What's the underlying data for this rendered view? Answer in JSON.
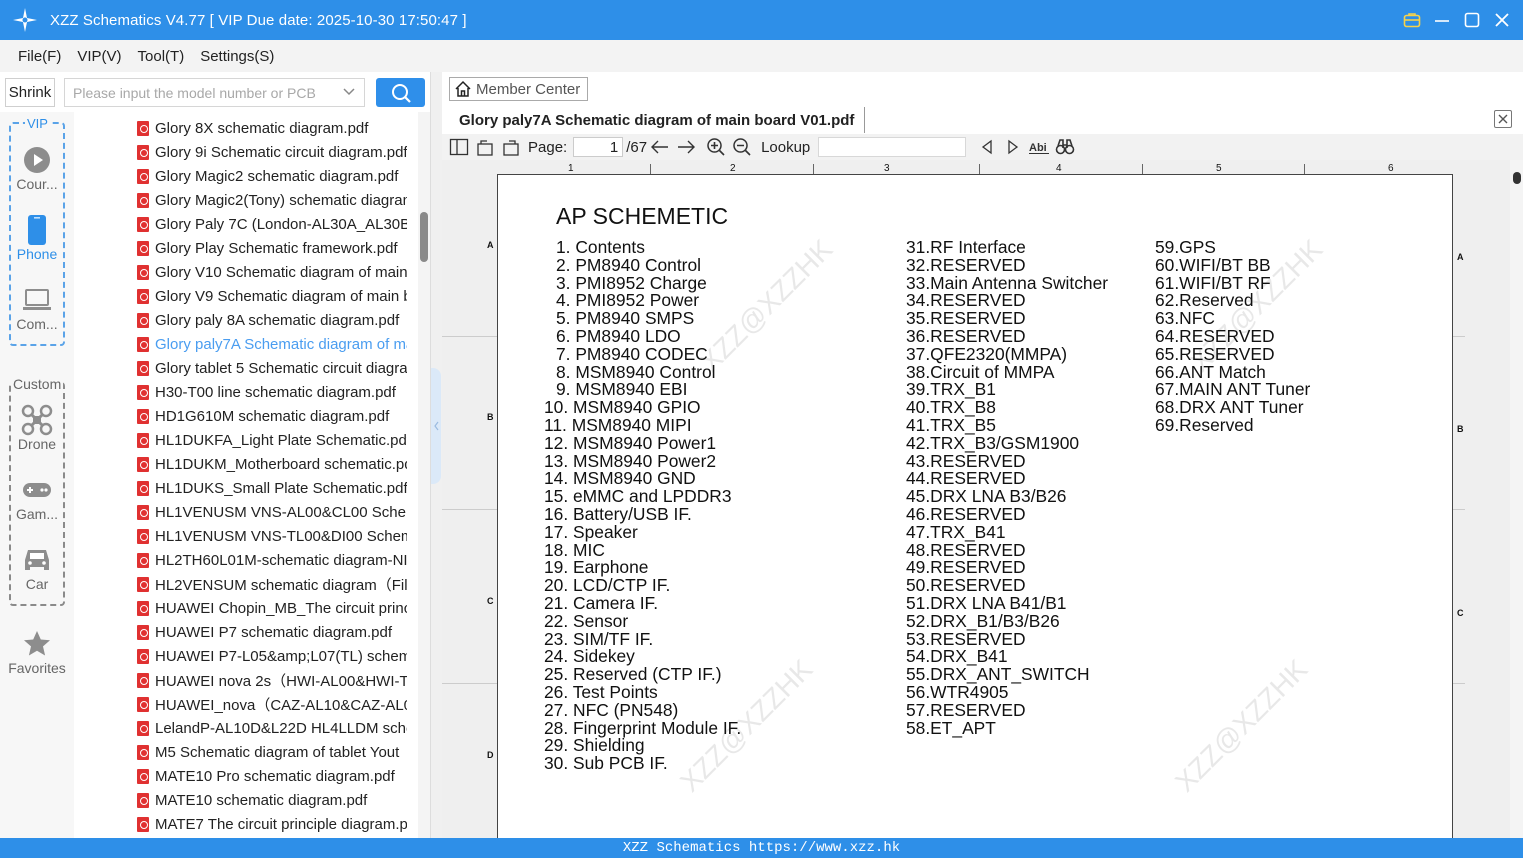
{
  "window": {
    "title": "XZZ Schematics V4.77 [ VIP Due date: 2025-10-30 17:50:47 ]"
  },
  "menu": [
    "File(F)",
    "VIP(V)",
    "Tool(T)",
    "Settings(S)"
  ],
  "search": {
    "shrink_label": "Shrink",
    "placeholder": "Please input the model number or PCB"
  },
  "sidebar": {
    "vip_label": "VIP",
    "custom_label": "Custom",
    "items": [
      {
        "label": "Cour...",
        "icon": "play-circle-icon"
      },
      {
        "label": "Phone",
        "icon": "phone-icon"
      },
      {
        "label": "Com...",
        "icon": "laptop-icon"
      },
      {
        "label": "Drone",
        "icon": "drone-icon"
      },
      {
        "label": "Gam...",
        "icon": "gamepad-icon"
      },
      {
        "label": "Car",
        "icon": "car-icon"
      },
      {
        "label": "Favorites",
        "icon": "star-icon"
      }
    ]
  },
  "files": [
    "Glory 8X schematic diagram.pdf",
    "Glory 9i Schematic circuit diagram.pdf",
    "Glory Magic2 schematic diagram.pdf",
    "Glory Magic2(Tony) schematic diagram",
    "Glory Paly 7C (London-AL30A_AL30B_",
    "Glory Play Schematic framework.pdf",
    "Glory V10 Schematic diagram of main",
    "Glory V9 Schematic diagram of main b",
    "Glory paly 8A schematic diagram.pdf",
    "Glory paly7A Schematic diagram of ma",
    "Glory tablet 5 Schematic circuit diagra",
    "H30-T00 line schematic diagram.pdf",
    "HD1G610M schematic diagram.pdf",
    "HL1DUKFA_Light Plate Schematic.pdf",
    "HL1DUKM_Motherboard schematic.pd",
    "HL1DUKS_Small Plate Schematic.pdf",
    "HL1VENUSM VNS-AL00&CL00 Schem",
    "HL1VENUSM VNS-TL00&DI00 Schema",
    "HL2TH60L01M-schematic diagram-NI",
    "HL2VENSUM schematic diagram（File",
    "HUAWEI Chopin_MB_The circuit princ",
    "HUAWEI P7 schematic diagram.pdf",
    "HUAWEI P7-L05&amp;L07(TL) schema",
    "HUAWEI nova 2s（HWI-AL00&HWI-TI",
    "HUAWEI_nova（CAZ-AL10&CAZ-AL00",
    "LelandP-AL10D&L22D HL4LLDM sche",
    "M5 Schematic diagram of tablet Yout",
    "MATE10 Pro schematic diagram.pdf",
    "MATE10 schematic diagram.pdf",
    "MATE7 The circuit principle diagram.p"
  ],
  "selected_file_index": 9,
  "viewer": {
    "member_center": "Member Center",
    "tab_title": "Glory paly7A Schematic diagram of main board V01.pdf",
    "page_label": "Page:",
    "page_current": "1",
    "page_total": "/67",
    "lookup_label": "Lookup"
  },
  "schematic": {
    "title": "AP SCHEMETIC",
    "ruler_top": [
      "1",
      "2",
      "3",
      "4",
      "5",
      "6"
    ],
    "row_marks": [
      "A",
      "B",
      "C",
      "D"
    ],
    "col1": [
      "1. Contents",
      "2. PM8940 Control",
      "3. PMI8952 Charge",
      "4. PMI8952 Power",
      "5. PM8940 SMPS",
      "6. PM8940 LDO",
      "7. PM8940 CODEC",
      "8. MSM8940 Control",
      "9. MSM8940 EBI",
      "10. MSM8940 GPIO",
      "11. MSM8940 MIPI",
      "12. MSM8940 Power1",
      "13. MSM8940 Power2",
      "14. MSM8940 GND",
      "15. eMMC and LPDDR3",
      "16. Battery/USB IF.",
      "17. Speaker",
      "18. MIC",
      "19. Earphone",
      "20. LCD/CTP IF.",
      "21. Camera IF.",
      "22. Sensor",
      "23. SIM/TF IF.",
      "24. Sidekey",
      "25. Reserved (CTP IF.)",
      "26. Test Points",
      "27. NFC (PN548)",
      "28. Fingerprint Module IF.",
      "29. Shielding",
      "30. Sub PCB IF."
    ],
    "col2": [
      "31.RF Interface",
      "32.RESERVED",
      "33.Main Antenna Switcher",
      "34.RESERVED",
      "35.RESERVED",
      "36.RESERVED",
      "37.QFE2320(MMPA)",
      "38.Circuit of MMPA",
      "39.TRX_B1",
      "40.TRX_B8",
      "41.TRX_B5",
      "42.TRX_B3/GSM1900",
      "43.RESERVED",
      "44.RESERVED",
      "45.DRX LNA B3/B26",
      "46.RESERVED",
      "47.TRX_B41",
      "48.RESERVED",
      "49.RESERVED",
      "50.RESERVED",
      "51.DRX LNA B41/B1",
      "52.DRX_B1/B3/B26",
      "53.RESERVED",
      "54.DRX_B41",
      "55.DRX_ANT_SWITCH",
      "56.WTR4905",
      "57.RESERVED",
      "58.ET_APT"
    ],
    "col3": [
      "59.GPS",
      "60.WIFI/BT BB",
      "61.WIFI/BT RF",
      "62.Reserved",
      "63.NFC",
      "64.RESERVED",
      "65.RESERVED",
      "66.ANT Match",
      "67.MAIN ANT Tuner",
      "68.DRX ANT Tuner",
      "69.Reserved"
    ],
    "watermark": "XZZ@XZZHK"
  },
  "status": {
    "text": "XZZ Schematics https://www.xzz.hk"
  },
  "colors": {
    "accent": "#2e8fe8",
    "selected_file": "#4a9df0",
    "pdf_icon": "#e03131"
  }
}
